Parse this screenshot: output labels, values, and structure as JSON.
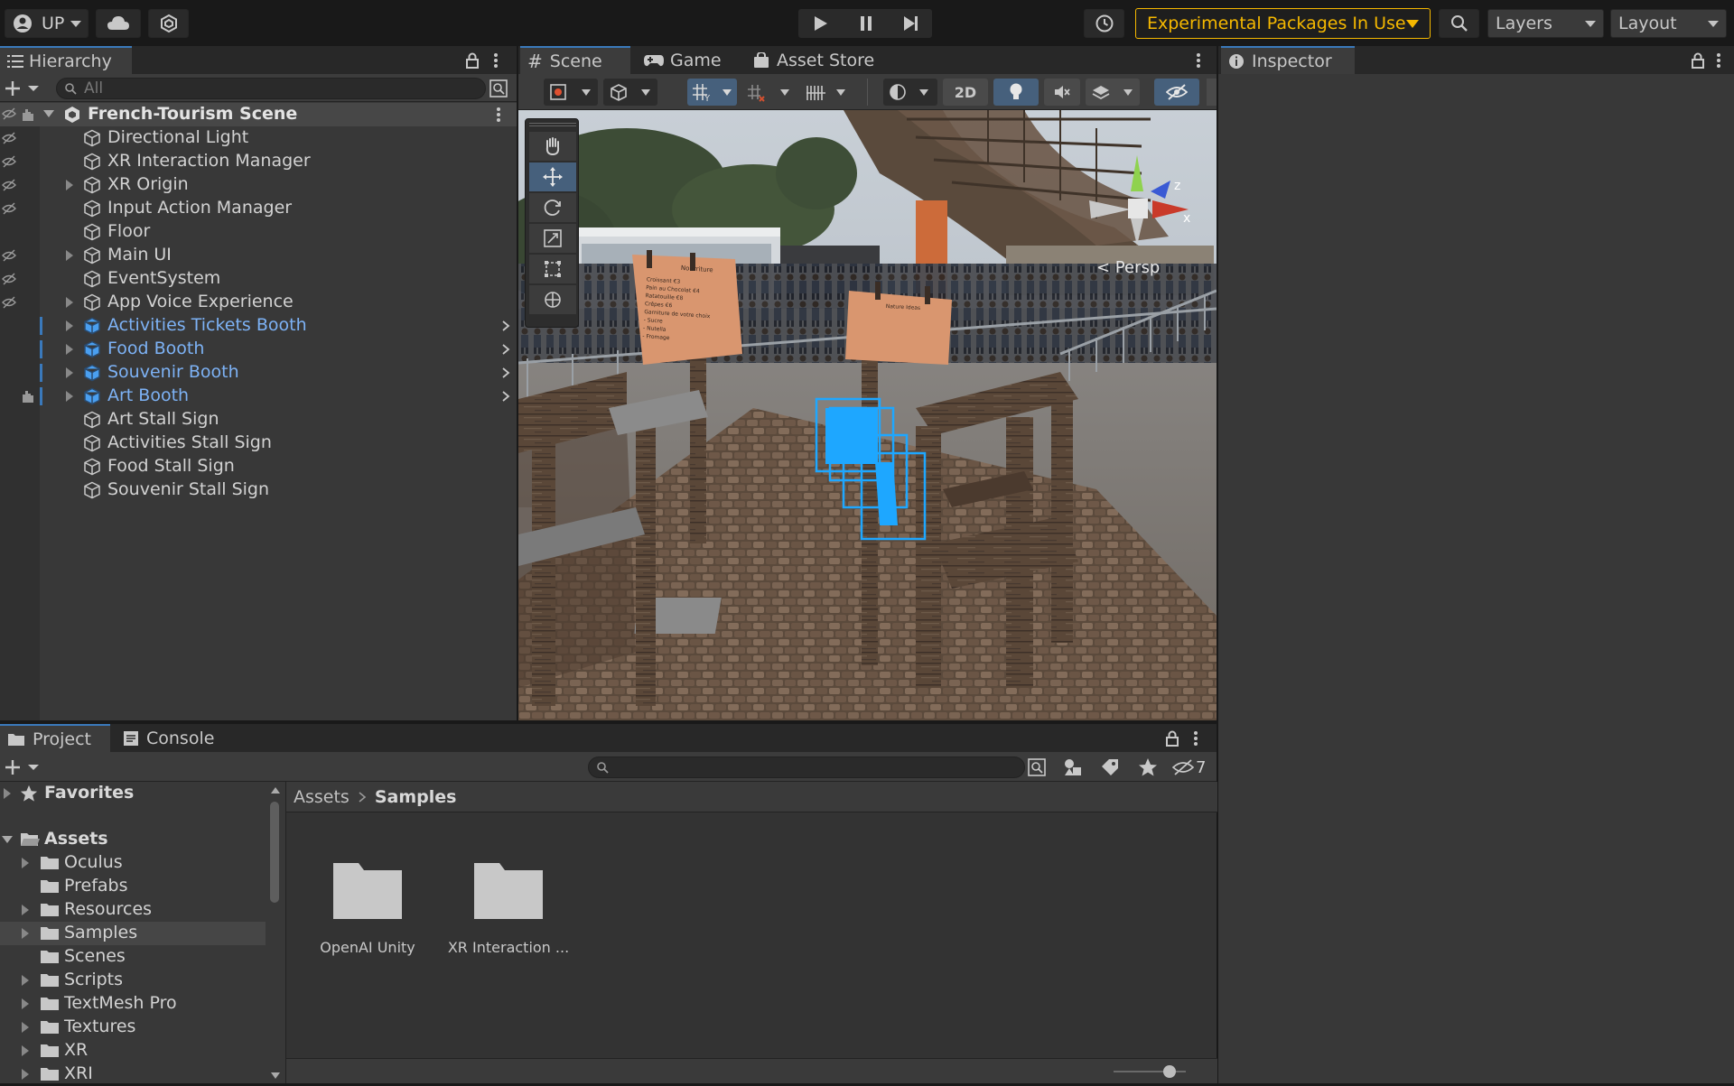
{
  "toolbar": {
    "account_label": "UP",
    "experimental_label": "Experimental Packages In Use",
    "layers_label": "Layers",
    "layout_label": "Layout"
  },
  "hierarchy": {
    "tab_label": "Hierarchy",
    "search_placeholder": "All",
    "scene_name": "French-Tourism Scene",
    "items": [
      {
        "label": "Directional Light",
        "expandable": false,
        "prefab": false
      },
      {
        "label": "XR Interaction Manager",
        "expandable": false,
        "prefab": false
      },
      {
        "label": "XR Origin",
        "expandable": true,
        "prefab": false
      },
      {
        "label": "Input Action Manager",
        "expandable": false,
        "prefab": false
      },
      {
        "label": "Floor",
        "expandable": false,
        "prefab": false
      },
      {
        "label": "Main UI",
        "expandable": true,
        "prefab": false
      },
      {
        "label": "EventSystem",
        "expandable": false,
        "prefab": false
      },
      {
        "label": "App Voice Experience",
        "expandable": true,
        "prefab": false
      },
      {
        "label": "Activities Tickets Booth",
        "expandable": true,
        "prefab": true
      },
      {
        "label": "Food Booth",
        "expandable": true,
        "prefab": true
      },
      {
        "label": "Souvenir Booth",
        "expandable": true,
        "prefab": true
      },
      {
        "label": "Art Booth",
        "expandable": true,
        "prefab": true
      },
      {
        "label": "Art Stall Sign",
        "expandable": false,
        "prefab": false
      },
      {
        "label": "Activities Stall Sign",
        "expandable": false,
        "prefab": false
      },
      {
        "label": "Food Stall Sign",
        "expandable": false,
        "prefab": false
      },
      {
        "label": "Souvenir Stall Sign",
        "expandable": false,
        "prefab": false
      }
    ]
  },
  "scene_view": {
    "tabs": [
      "Scene",
      "Game",
      "Asset Store"
    ],
    "mode_2d": "2D",
    "persp_label": "< Persp",
    "axis_x": "x",
    "axis_z": "z",
    "sign_left_title": "Nourriture",
    "sign_left_lines": [
      "Croissant  €3",
      "Pain au Chocolat  €4",
      "Ratatouille  €8",
      "Crêpes  €6",
      "Garniture de votre choix",
      "- Sucre",
      "- Nutella",
      "- Fromage"
    ],
    "sign_right_title": "Nature Ideas"
  },
  "inspector": {
    "tab_label": "Inspector"
  },
  "project": {
    "tabs": [
      "Project",
      "Console"
    ],
    "hidden_count": "7",
    "favorites_label": "Favorites",
    "assets_label": "Assets",
    "folders": [
      {
        "label": "Oculus",
        "expandable": true
      },
      {
        "label": "Prefabs",
        "expandable": false
      },
      {
        "label": "Resources",
        "expandable": true
      },
      {
        "label": "Samples",
        "expandable": true,
        "selected": true
      },
      {
        "label": "Scenes",
        "expandable": false
      },
      {
        "label": "Scripts",
        "expandable": true
      },
      {
        "label": "TextMesh Pro",
        "expandable": true
      },
      {
        "label": "Textures",
        "expandable": true
      },
      {
        "label": "XR",
        "expandable": true
      },
      {
        "label": "XRI",
        "expandable": true
      }
    ],
    "breadcrumb": [
      "Assets",
      "Samples"
    ],
    "grid_items": [
      "OpenAI Unity",
      "XR Interaction ..."
    ],
    "zoom_slider_value": 0.78
  },
  "colors": {
    "accent": "#3a79bb",
    "warning": "#f5b800",
    "prefab_blue": "#7db2f5",
    "selection_blue": "#1ea7ff"
  }
}
